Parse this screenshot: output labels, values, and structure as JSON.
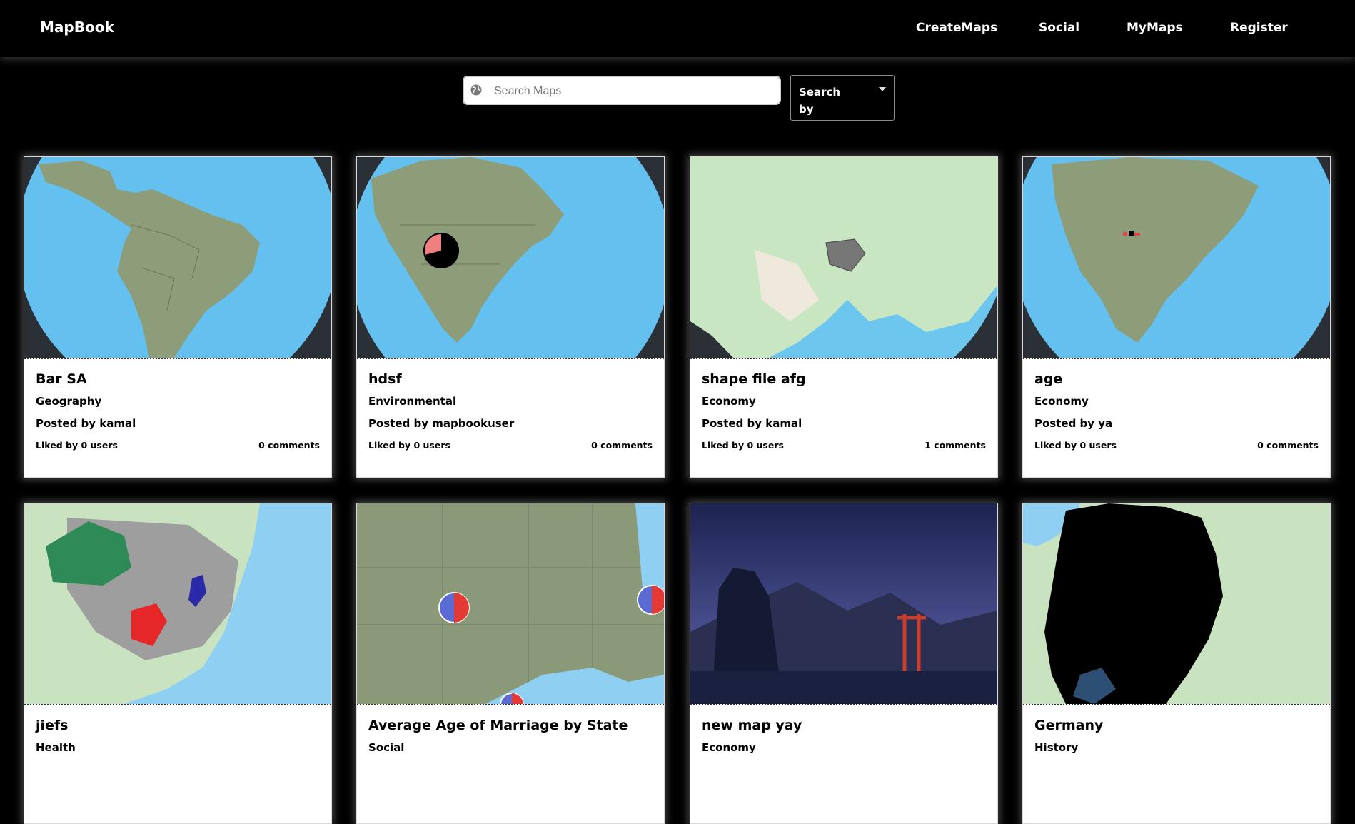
{
  "app": {
    "title": "MapBook"
  },
  "nav": {
    "create": "CreateMaps",
    "social": "Social",
    "mymaps": "MyMaps",
    "register": "Register"
  },
  "search": {
    "placeholder": "Search Maps",
    "value": "",
    "search_by_label": "Search by"
  },
  "cards": [
    {
      "title": "Bar SA",
      "category": "Geography",
      "posted": "Posted by kamal",
      "likes": "Liked by 0 users",
      "comments": "0 comments"
    },
    {
      "title": "hdsf",
      "category": "Environmental",
      "posted": "Posted by mapbookuser",
      "likes": "Liked by 0 users",
      "comments": "0 comments"
    },
    {
      "title": "shape file afg",
      "category": "Economy",
      "posted": "Posted by kamal",
      "likes": "Liked by 0 users",
      "comments": "1 comments"
    },
    {
      "title": "age",
      "category": "Economy",
      "posted": "Posted by ya",
      "likes": "Liked by 0 users",
      "comments": "0 comments"
    },
    {
      "title": "jiefs",
      "category": "Health",
      "posted": "",
      "likes": "",
      "comments": ""
    },
    {
      "title": "Average Age of Marriage by State",
      "category": "Social",
      "posted": "",
      "likes": "",
      "comments": ""
    },
    {
      "title": "new map yay",
      "category": "Economy",
      "posted": "",
      "likes": "",
      "comments": ""
    },
    {
      "title": "Germany",
      "category": "History",
      "posted": "",
      "likes": "",
      "comments": ""
    }
  ],
  "colors": {
    "background": "#000000",
    "ocean": "#6cc3ee",
    "land": "#8b9a78",
    "card": "#ffffff",
    "accent_red": "#e53935",
    "accent_blue": "#3f51b5"
  }
}
